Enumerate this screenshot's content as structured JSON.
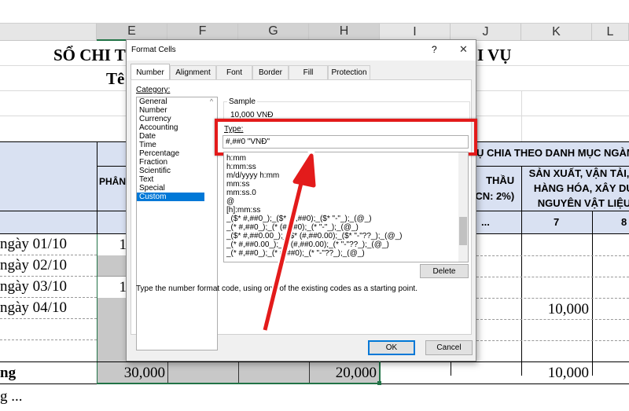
{
  "columns": [
    "E",
    "F",
    "G",
    "H",
    "I",
    "J",
    "K",
    "L"
  ],
  "sheet": {
    "title1": "SỔ CHI T",
    "title1_right": "I VỤ",
    "title2": "Tê",
    "header_top": "Ụ CHIA THEO DANH MỤC NGÀN",
    "header_e": "PHÂN",
    "header_j": "THẦU\n(CN: 2%)",
    "header_k": "SẢN XUẤT, VẬN TẢI, D\nHÀNG HÓA, XÂY DỰ\nNGUYÊN VẬT LIỆU",
    "num_j": "...",
    "num_k": "7",
    "num_l": "8",
    "rows": [
      "ngày 01/10",
      "ngày 02/10",
      "ngày 03/10",
      "ngày 04/10"
    ],
    "e_vals": [
      "1",
      "",
      "1",
      ""
    ],
    "k_row4": "10,000",
    "total_label": "ng",
    "total_e": "30,000",
    "total_h": "20,000",
    "total_k": "10,000",
    "footer": "g ..."
  },
  "dialog": {
    "title": "Format Cells",
    "help": "?",
    "close": "✕",
    "tabs": [
      "Number",
      "Alignment",
      "Font",
      "Border",
      "Fill",
      "Protection"
    ],
    "category_label": "Category:",
    "categories": [
      "General",
      "Number",
      "Currency",
      "Accounting",
      "Date",
      "Time",
      "Percentage",
      "Fraction",
      "Scientific",
      "Text",
      "Special",
      "Custom"
    ],
    "selected_category": "Custom",
    "sample_label": "Sample",
    "sample_value": "10,000 VNĐ",
    "type_label": "Type:",
    "type_value": "#,##0 \"VNĐ\"",
    "formats": [
      "h:mm",
      "h:mm:ss",
      "m/d/yyyy h:mm",
      "mm:ss",
      "mm:ss.0",
      "@",
      "[h]:mm:ss",
      "_($* #,##0_);_($* (#,##0);_($* \"-\"_);_(@_)",
      "_(* #,##0_);_(* (#,##0);_(* \"-\"_);_(@_)",
      "_($* #,##0.00_);_($* (#,##0.00);_($* \"-\"??_);_(@_)",
      "_(* #,##0.00_);_(* (#,##0.00);_(* \"-\"??_);_(@_)",
      "_(* #,##0_);_(* #,##0);_(* \"-\"??_);_(@_)"
    ],
    "delete": "Delete",
    "hint": "Type the number format code, using one of the existing codes as a starting point.",
    "ok": "OK",
    "cancel": "Cancel"
  },
  "colors": {
    "highlight": "#e31b1b",
    "header_fill": "#d9e1f2",
    "selection": "#0078d7",
    "excel_green": "#217346"
  }
}
